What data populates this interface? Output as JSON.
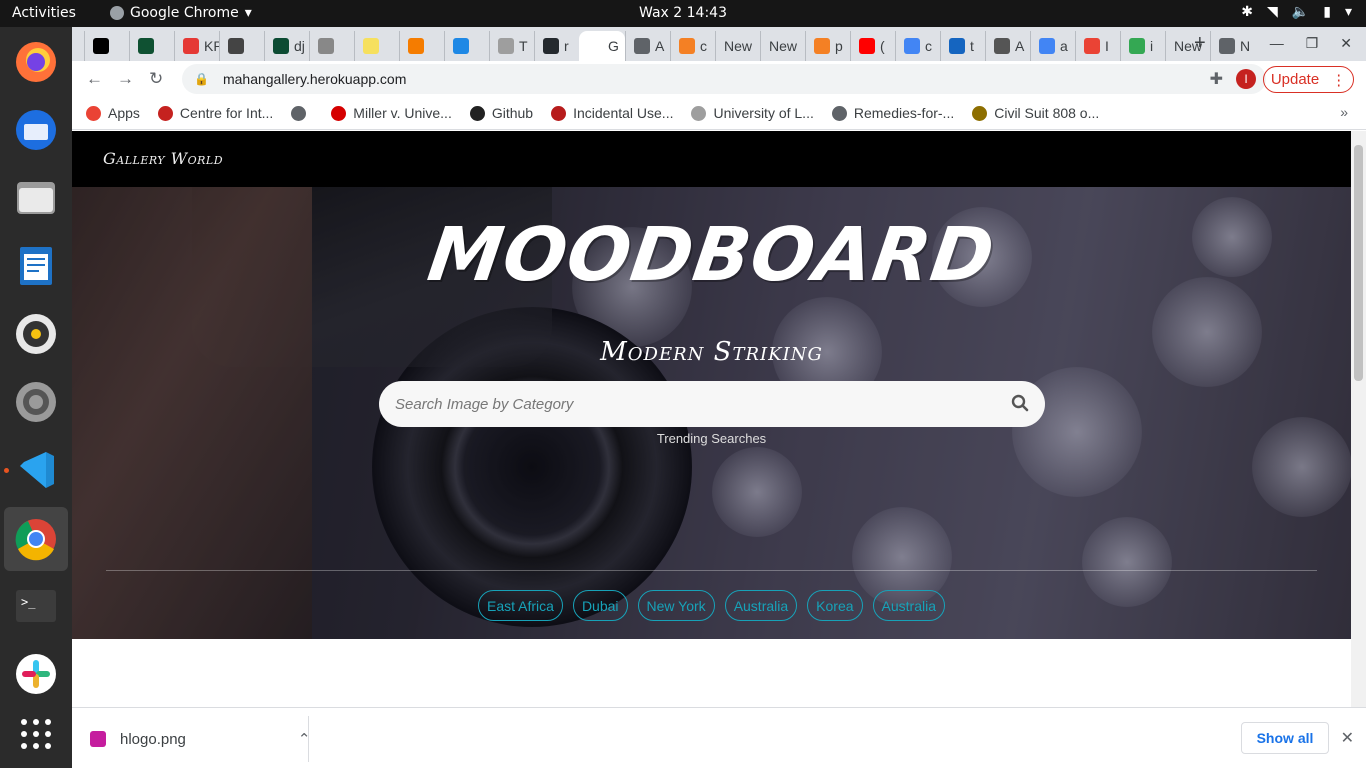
{
  "system": {
    "activities": "Activities",
    "app_name": "Google Chrome",
    "clock": "Wax 2  14:43"
  },
  "tabs": [
    {
      "label": "",
      "color": "#000000"
    },
    {
      "label": "",
      "color": "#0f5132"
    },
    {
      "label": "KP",
      "color": "#e53935"
    },
    {
      "label": "",
      "color": "#444444"
    },
    {
      "label": "dj",
      "color": "#0c4b33"
    },
    {
      "label": "",
      "color": "#888888"
    },
    {
      "label": "",
      "color": "#f6e05e"
    },
    {
      "label": "",
      "color": "#f57c00"
    },
    {
      "label": "",
      "color": "#1e88e5"
    },
    {
      "label": "T",
      "color": "#9e9e9e"
    },
    {
      "label": "r",
      "color": "#24292e"
    },
    {
      "label": "G",
      "color": "#ffffff",
      "active": true
    },
    {
      "label": "A",
      "color": "#5f6368"
    },
    {
      "label": "c",
      "color": "#f48024"
    },
    {
      "label": "New",
      "color": ""
    },
    {
      "label": "New",
      "color": ""
    },
    {
      "label": "p",
      "color": "#f48024"
    },
    {
      "label": "(",
      "color": "#ff0000"
    },
    {
      "label": "c",
      "color": "#4285f4"
    },
    {
      "label": "t",
      "color": "#1565c0"
    },
    {
      "label": "A",
      "color": "#555555"
    },
    {
      "label": "a",
      "color": "#4285f4"
    },
    {
      "label": "I",
      "color": "#ea4335"
    },
    {
      "label": "i",
      "color": "#34a853"
    },
    {
      "label": "New",
      "color": ""
    },
    {
      "label": "N",
      "color": "#5f6368"
    }
  ],
  "toolbar": {
    "url": "mahangallery.herokuapp.com",
    "profile_initial": "I",
    "update_label": "Update"
  },
  "bookmarks": [
    {
      "label": "Apps",
      "icon": "apps-grid-icon"
    },
    {
      "label": "Centre for Int...",
      "icon": "c-logo-icon"
    },
    {
      "label": "",
      "icon": "globe-icon"
    },
    {
      "label": "Miller v. Unive...",
      "icon": "red-logo-icon"
    },
    {
      "label": "Github",
      "icon": "angular-icon"
    },
    {
      "label": "Incidental Use...",
      "icon": "red-dark-icon"
    },
    {
      "label": "University of L...",
      "icon": "uni-icon"
    },
    {
      "label": "Remedies-for-...",
      "icon": "globe-icon"
    },
    {
      "label": "Civil Suit 808 o...",
      "icon": "court-icon"
    }
  ],
  "page": {
    "brand": "Gallery World",
    "hero_title": "MOODBOARD",
    "hero_subtitle": "Modern Striking",
    "search_placeholder": "Search Image by Category",
    "trending_label": "Trending Searches",
    "chips": [
      "East Africa",
      "Dubai",
      "New York",
      "Australia",
      "Korea",
      "Australia"
    ]
  },
  "downloads": {
    "file_name": "hlogo.png",
    "show_all_label": "Show all"
  }
}
